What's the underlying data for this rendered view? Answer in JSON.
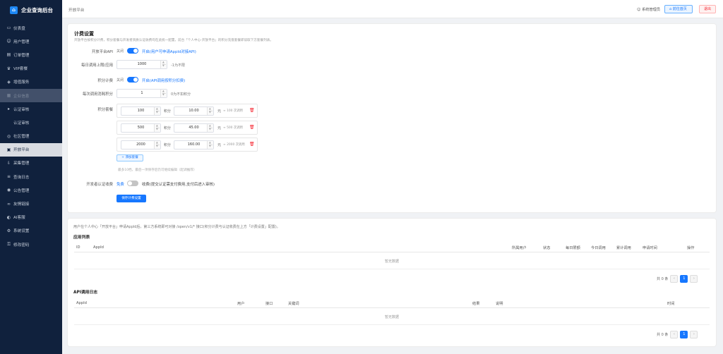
{
  "brand": {
    "title": "企业查询后台"
  },
  "sidebar": {
    "items": [
      {
        "label": "仪表盘",
        "icon": "dashboard-icon"
      },
      {
        "label": "用户管理",
        "icon": "user-icon"
      },
      {
        "label": "订单管理",
        "icon": "order-icon"
      },
      {
        "label": "VIP套餐",
        "icon": "vip-icon"
      },
      {
        "label": "增值服务",
        "icon": "service-icon"
      },
      {
        "label": "企业信息",
        "icon": "company-icon"
      },
      {
        "label": "认证审核",
        "icon": "audit-icon"
      },
      {
        "label": "认证审核",
        "icon": ""
      },
      {
        "label": "社区管理",
        "icon": "community-icon"
      },
      {
        "label": "开放平台",
        "icon": "platform-icon"
      },
      {
        "label": "采集管理",
        "icon": "collect-icon"
      },
      {
        "label": "查询日志",
        "icon": "log-icon"
      },
      {
        "label": "公告管理",
        "icon": "notice-icon"
      },
      {
        "label": "友情链接",
        "icon": "link-icon"
      },
      {
        "label": "AI客服",
        "icon": "ai-icon"
      },
      {
        "label": "系统设置",
        "icon": "settings-icon"
      },
      {
        "label": "修改密码",
        "icon": "lock-icon"
      }
    ]
  },
  "topbar": {
    "breadcrumb": "开放平台",
    "admin": "系统管理员",
    "home_button": "前往首页",
    "logout_button": "退出"
  },
  "billing": {
    "title": "计费设置",
    "desc": "开放平台按积分计费，积分套餐与开发者资质认证收费均在此统一配置，前台「个人中心-开放平台」的积分充值套餐即读取下方套餐列表。",
    "api_label": "开放平台API",
    "api_off": "关闭",
    "api_on": "开启(用户可申请AppId对接API)",
    "daily_label": "每日调用上限/应用",
    "daily_value": "1000",
    "daily_hint": "-1为不限",
    "points_label": "积分计费",
    "points_off": "关闭",
    "points_on": "开启(API调用按积分扣费)",
    "cost_label": "每次调用消耗积分",
    "cost_value": "1",
    "cost_hint": "0为不扣积分",
    "pkg_label": "积分套餐",
    "pkg_unit_points": "积分",
    "pkg_unit_yuan": "元",
    "packages": [
      {
        "points": "100",
        "price": "10.00",
        "calls": "≈ 100 次调用"
      },
      {
        "points": "500",
        "price": "45.00",
        "calls": "≈ 500 次调用"
      },
      {
        "points": "2000",
        "price": "160.00",
        "calls": "≈ 2000 次调用"
      }
    ],
    "add_button": "+ 添加套餐",
    "pkg_hint": "最多10档，最后一项保存后仍可继续编辑（起调推荐）",
    "cert_label": "开发者认证收费",
    "cert_free": "免费",
    "cert_paid": "收费(提交认证需支付费用,支付后进入审核)",
    "save_button": "保存计费设置"
  },
  "apps": {
    "intro": "用户在个人中心「开放平台」申请AppId后，第三方系统即可对接 /open/v1/* 接口(积分计费与认证收费在上方「计费设置」配置)。",
    "title": "应用列表",
    "columns": [
      "ID",
      "AppId",
      "所属用户",
      "状态",
      "每日限额",
      "今日调用",
      "累计调用",
      "申请时间",
      "操作"
    ],
    "empty": "暂无数据",
    "total": "共 0 条",
    "page": "1"
  },
  "logs": {
    "title": "API调用日志",
    "columns": [
      "AppId",
      "用户",
      "接口",
      "关键词",
      "结果",
      "说明",
      "时间"
    ],
    "empty": "暂无数据",
    "total": "共 0 条",
    "page": "1"
  }
}
